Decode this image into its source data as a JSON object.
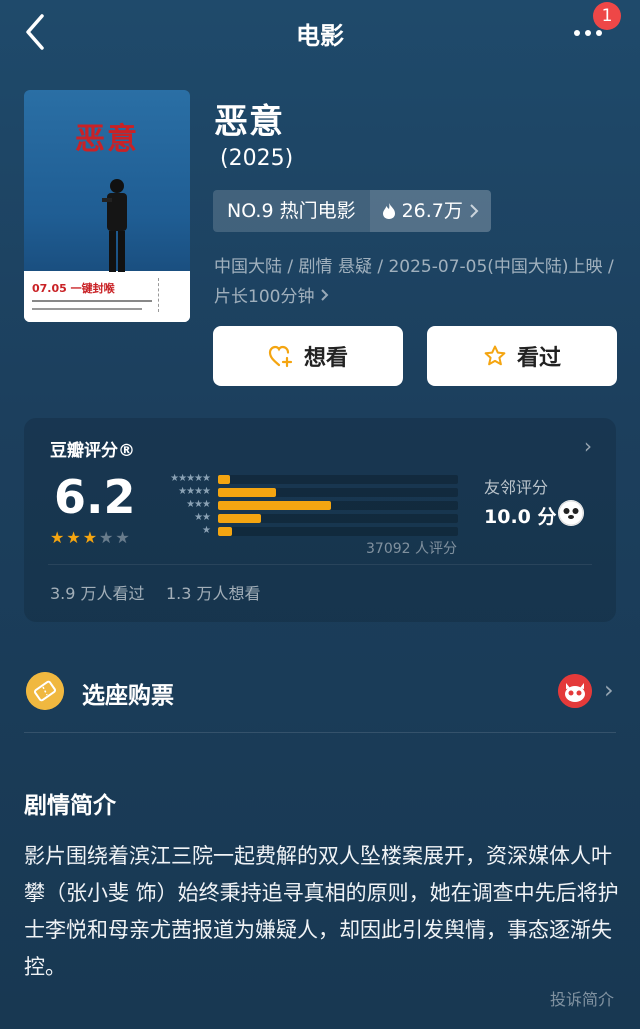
{
  "header": {
    "title": "电影",
    "badge_count": "1"
  },
  "movie": {
    "title": "恶意",
    "year": "(2025)",
    "rank_label": "NO.9 热门电影",
    "heat": "26.7万",
    "meta": "中国大陆 / 剧情 悬疑 / 2025-07-05(中国大陆)上映 / 片长100分钟",
    "poster": {
      "title": "恶意",
      "date": "07.05 一键封喉"
    }
  },
  "actions": {
    "want_label": "想看",
    "watched_label": "看过"
  },
  "rating": {
    "title": "豆瓣评分®",
    "score": "6.2",
    "star_fill": 3,
    "distribution": [
      5,
      24,
      47,
      18,
      6
    ],
    "count_text": "37092 人评分",
    "friend_label": "友邻评分",
    "friend_score": "10.0 分",
    "watched_text": "3.9 万人看过",
    "wish_text": "1.3 万人想看"
  },
  "tickets": {
    "label": "选座购票"
  },
  "synopsis": {
    "title": "剧情简介",
    "body": "影片围绕着滨江三院一起费解的双人坠楼案展开，资深媒体人叶攀（张小斐 饰）始终秉持追寻真相的原则，她在调查中先后将护士李悦和母亲尤茜报道为嫌疑人，却因此引发舆情，事态逐渐失控。",
    "report_label": "投诉简介"
  },
  "colors": {
    "accent": "#f4a511",
    "badge": "#ee4747",
    "star": "#f4a511"
  }
}
